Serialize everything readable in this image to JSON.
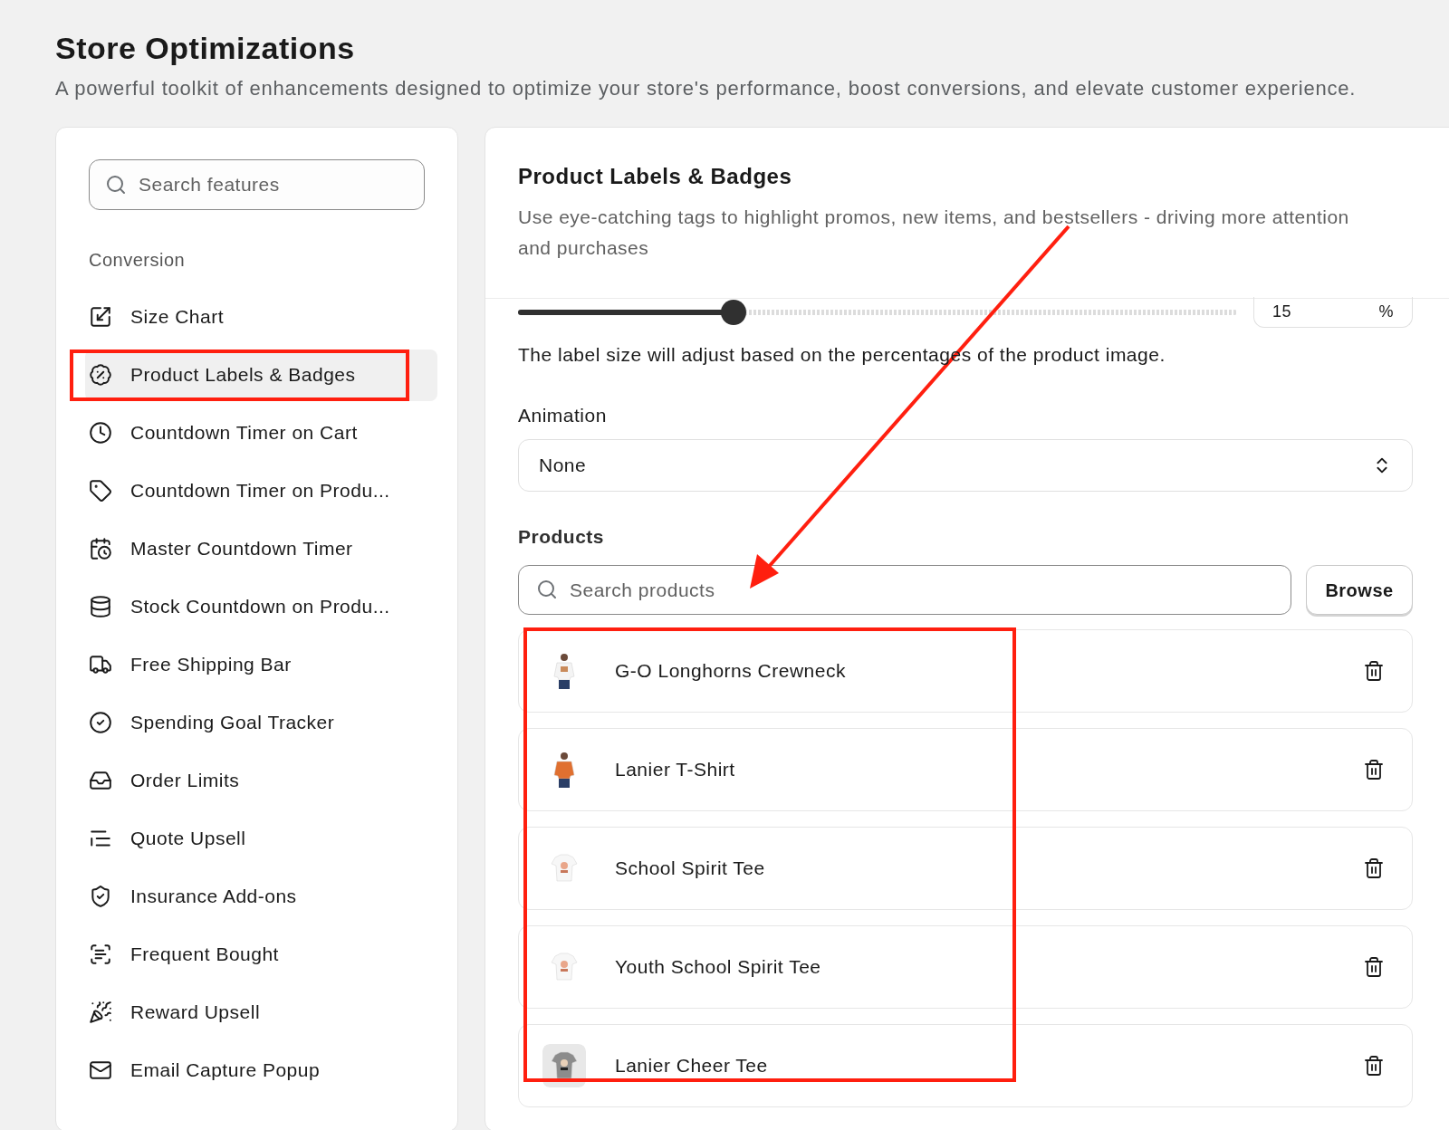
{
  "page": {
    "title": "Store Optimizations",
    "subtitle": "A powerful toolkit of enhancements designed to optimize your store's performance, boost conversions, and elevate customer experience."
  },
  "sidebar": {
    "search": {
      "placeholder": "Search features"
    },
    "section": "Conversion",
    "items": [
      {
        "label": "Size Chart",
        "selected": false
      },
      {
        "label": "Product Labels & Badges",
        "selected": true
      },
      {
        "label": "Countdown Timer on Cart",
        "selected": false
      },
      {
        "label": "Countdown Timer on Produ...",
        "selected": false
      },
      {
        "label": "Master Countdown Timer",
        "selected": false
      },
      {
        "label": "Stock Countdown on Produ...",
        "selected": false
      },
      {
        "label": "Free Shipping Bar",
        "selected": false
      },
      {
        "label": "Spending Goal Tracker",
        "selected": false
      },
      {
        "label": "Order Limits",
        "selected": false
      },
      {
        "label": "Quote Upsell",
        "selected": false
      },
      {
        "label": "Insurance Add-ons",
        "selected": false
      },
      {
        "label": "Frequent Bought",
        "selected": false
      },
      {
        "label": "Reward Upsell",
        "selected": false
      },
      {
        "label": "Email Capture Popup",
        "selected": false
      }
    ]
  },
  "panel": {
    "title": "Product Labels & Badges",
    "description": "Use eye-catching tags to highlight promos, new items, and bestsellers - driving more attention and purchases",
    "size": {
      "level": 0.3,
      "value": "15",
      "unit": "%",
      "help": "The label size will adjust based on the percentages of the product image."
    },
    "animation": {
      "label": "Animation",
      "value": "None"
    },
    "products": {
      "label": "Products",
      "search": {
        "placeholder": "Search products"
      },
      "browse": "Browse",
      "items": [
        {
          "name": "G-O Longhorns Crewneck",
          "kind": "person-white"
        },
        {
          "name": "Lanier T-Shirt",
          "kind": "person-orange"
        },
        {
          "name": "School Spirit Tee",
          "kind": "tee-white"
        },
        {
          "name": "Youth School Spirit Tee",
          "kind": "tee-white"
        },
        {
          "name": "Lanier Cheer Tee",
          "kind": "tee-gray"
        }
      ]
    }
  },
  "annotations": [
    {
      "kind": "box"
    },
    {
      "kind": "arrow"
    },
    {
      "kind": "box"
    }
  ]
}
